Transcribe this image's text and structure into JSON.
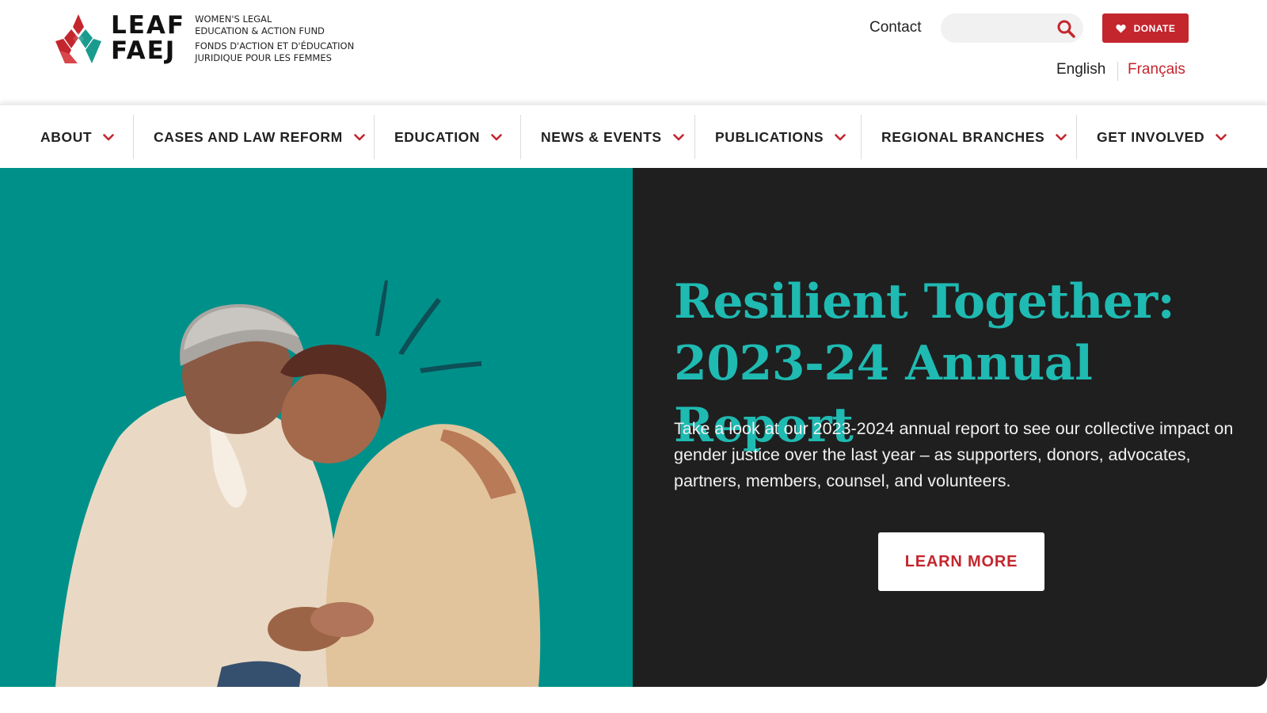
{
  "header": {
    "logo": {
      "line1": "LEAF",
      "line2": "FAEJ",
      "tagline_en_1": "Women's Legal",
      "tagline_en_2": "Education & Action Fund",
      "tagline_fr_1": "Fonds d'action et d'éducation",
      "tagline_fr_2": "juridique pour les femmes"
    },
    "contact_label": "Contact",
    "search": {
      "placeholder": "",
      "icon": "search-icon"
    },
    "donate_label": "DONATE",
    "languages": {
      "english": "English",
      "french": "Français",
      "active": "English"
    }
  },
  "nav": {
    "items": [
      {
        "label": "ABOUT"
      },
      {
        "label": "CASES AND LAW REFORM"
      },
      {
        "label": "EDUCATION"
      },
      {
        "label": "NEWS & EVENTS"
      },
      {
        "label": "PUBLICATIONS"
      },
      {
        "label": "REGIONAL BRANCHES"
      },
      {
        "label": "GET INVOLVED"
      }
    ]
  },
  "hero": {
    "title": "Resilient Together: 2023-24 Annual Report",
    "description": "Take a look at our 2023-2024 annual report to see our collective impact on gender justice over the last year – as supporters, donors, advocates, partners, members, counsel, and volunteers.",
    "cta_label": "LEARN MORE",
    "image": "two-women-embracing-illustration"
  },
  "colors": {
    "brand_red": "#c4262e",
    "brand_teal": "#00908a",
    "title_teal": "#1fbab2",
    "hero_dark": "#1f1f1f"
  }
}
